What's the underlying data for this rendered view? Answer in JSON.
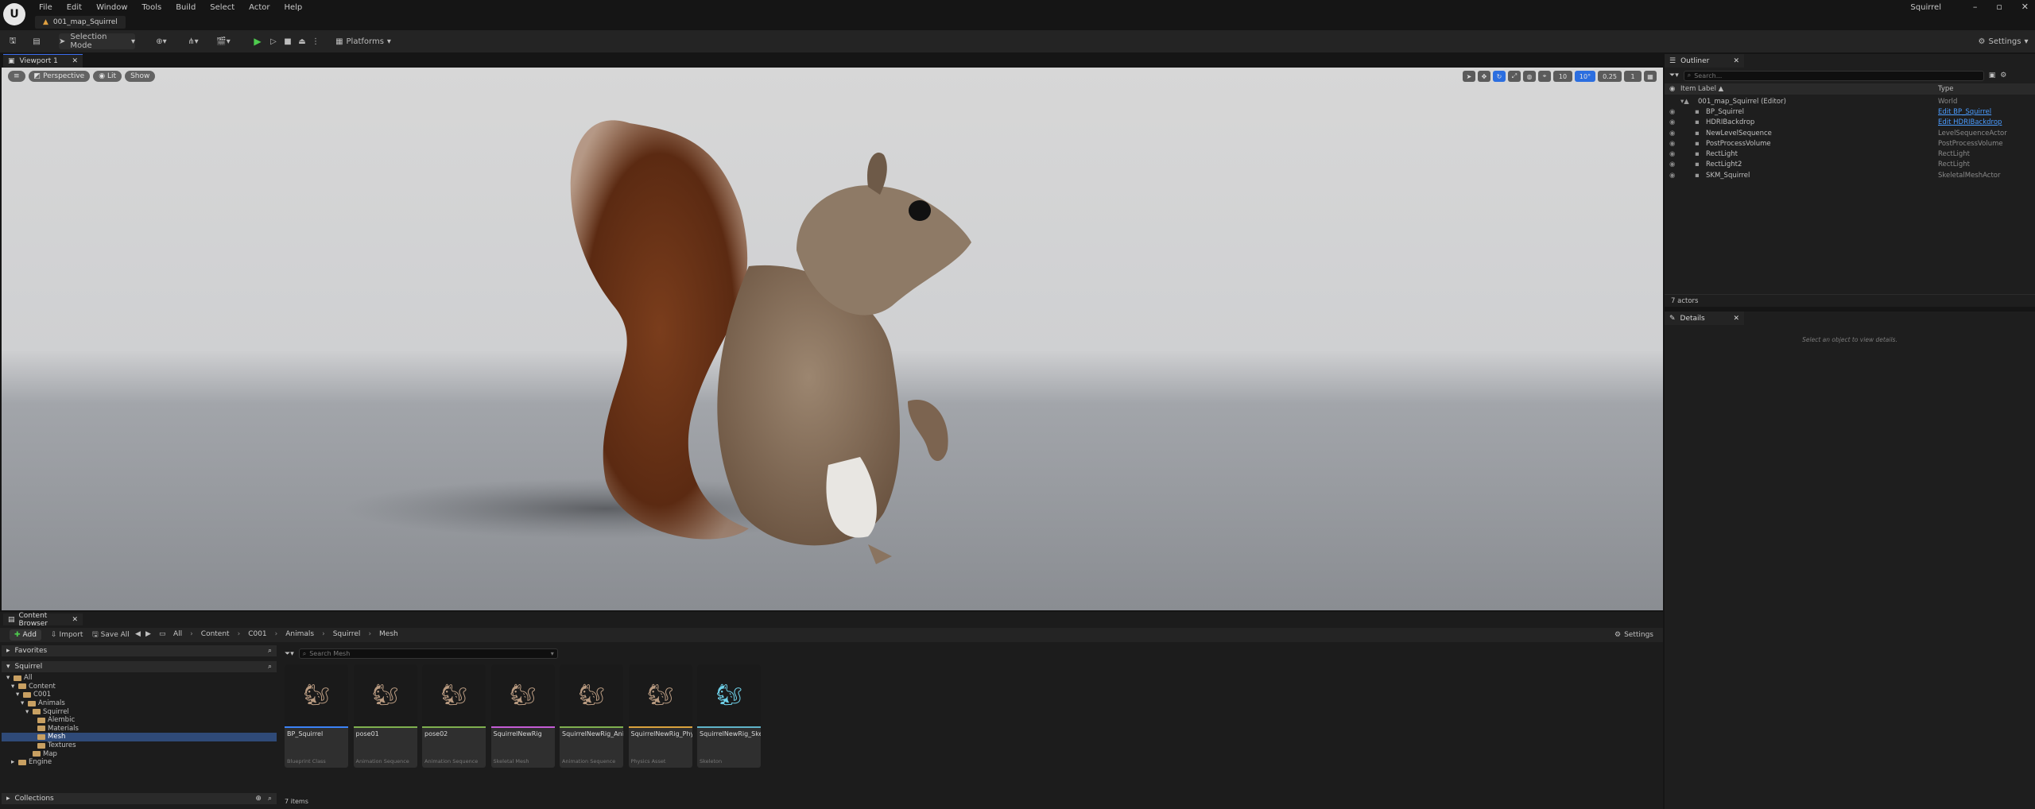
{
  "app": {
    "project_name": "Squirrel",
    "map_tab": "001_map_Squirrel",
    "menu": [
      "File",
      "Edit",
      "Window",
      "Tools",
      "Build",
      "Select",
      "Actor",
      "Help"
    ]
  },
  "toolbar": {
    "selection_mode": "Selection Mode",
    "platforms": "Platforms",
    "settings": "Settings"
  },
  "viewport": {
    "tab_label": "Viewport 1",
    "perspective": "Perspective",
    "lit": "Lit",
    "show": "Show",
    "grid_snap": "10",
    "rot_snap": "10°",
    "scale_snap": "0.25",
    "cam_speed": "1"
  },
  "outliner": {
    "title": "Outliner",
    "search_placeholder": "Search...",
    "col_label": "Item Label ▲",
    "col_type": "Type",
    "rows": [
      {
        "label": "001_map_Squirrel (Editor)",
        "type": "World",
        "indent": 0,
        "link": false
      },
      {
        "label": "BP_Squirrel",
        "type": "Edit BP_Squirrel",
        "indent": 1,
        "link": true
      },
      {
        "label": "HDRIBackdrop",
        "type": "Edit HDRIBackdrop",
        "indent": 1,
        "link": true
      },
      {
        "label": "NewLevelSequence",
        "type": "LevelSequenceActor",
        "indent": 1,
        "link": false
      },
      {
        "label": "PostProcessVolume",
        "type": "PostProcessVolume",
        "indent": 1,
        "link": false
      },
      {
        "label": "RectLight",
        "type": "RectLight",
        "indent": 1,
        "link": false
      },
      {
        "label": "RectLight2",
        "type": "RectLight",
        "indent": 1,
        "link": false
      },
      {
        "label": "SKM_Squirrel",
        "type": "SkeletalMeshActor",
        "indent": 1,
        "link": false
      }
    ],
    "actor_count": "7 actors"
  },
  "details": {
    "title": "Details",
    "empty_hint": "Select an object to view details."
  },
  "content_browser": {
    "tab_label": "Content Browser",
    "add": "Add",
    "import": "Import",
    "save_all": "Save All",
    "breadcrumb": [
      "All",
      "Content",
      "C001",
      "Animals",
      "Squirrel",
      "Mesh"
    ],
    "settings": "Settings",
    "favorites": "Favorites",
    "root": "Squirrel",
    "search_folders_placeholder": "Search Mesh",
    "tree": [
      {
        "label": "All",
        "depth": 0,
        "selected": false
      },
      {
        "label": "Content",
        "depth": 1,
        "selected": false
      },
      {
        "label": "C001",
        "depth": 2,
        "selected": false
      },
      {
        "label": "Animals",
        "depth": 3,
        "selected": false
      },
      {
        "label": "Squirrel",
        "depth": 4,
        "selected": false
      },
      {
        "label": "Alembic",
        "depth": 5,
        "selected": false
      },
      {
        "label": "Materials",
        "depth": 5,
        "selected": false
      },
      {
        "label": "Mesh",
        "depth": 5,
        "selected": true
      },
      {
        "label": "Textures",
        "depth": 5,
        "selected": false
      },
      {
        "label": "Map",
        "depth": 4,
        "selected": false
      },
      {
        "label": "Engine",
        "depth": 1,
        "selected": false
      }
    ],
    "collections": "Collections",
    "assets": [
      {
        "name": "BP_Squirrel",
        "class": "Blueprint Class",
        "color": "#3b82f6"
      },
      {
        "name": "pose01",
        "class": "Animation Sequence",
        "color": "#7fb04f"
      },
      {
        "name": "pose02",
        "class": "Animation Sequence",
        "color": "#7fb04f"
      },
      {
        "name": "SquirrelNewRig",
        "class": "Skeletal Mesh",
        "color": "#c45cd6"
      },
      {
        "name": "SquirrelNewRig_Anim",
        "class": "Animation Sequence",
        "color": "#7fb04f"
      },
      {
        "name": "SquirrelNewRig_PhysicsAsset",
        "class": "Physics Asset",
        "color": "#d9a23c"
      },
      {
        "name": "SquirrelNewRig_Skeleton",
        "class": "Skeleton",
        "color": "#5fb3c9"
      }
    ],
    "item_count": "7 items"
  }
}
